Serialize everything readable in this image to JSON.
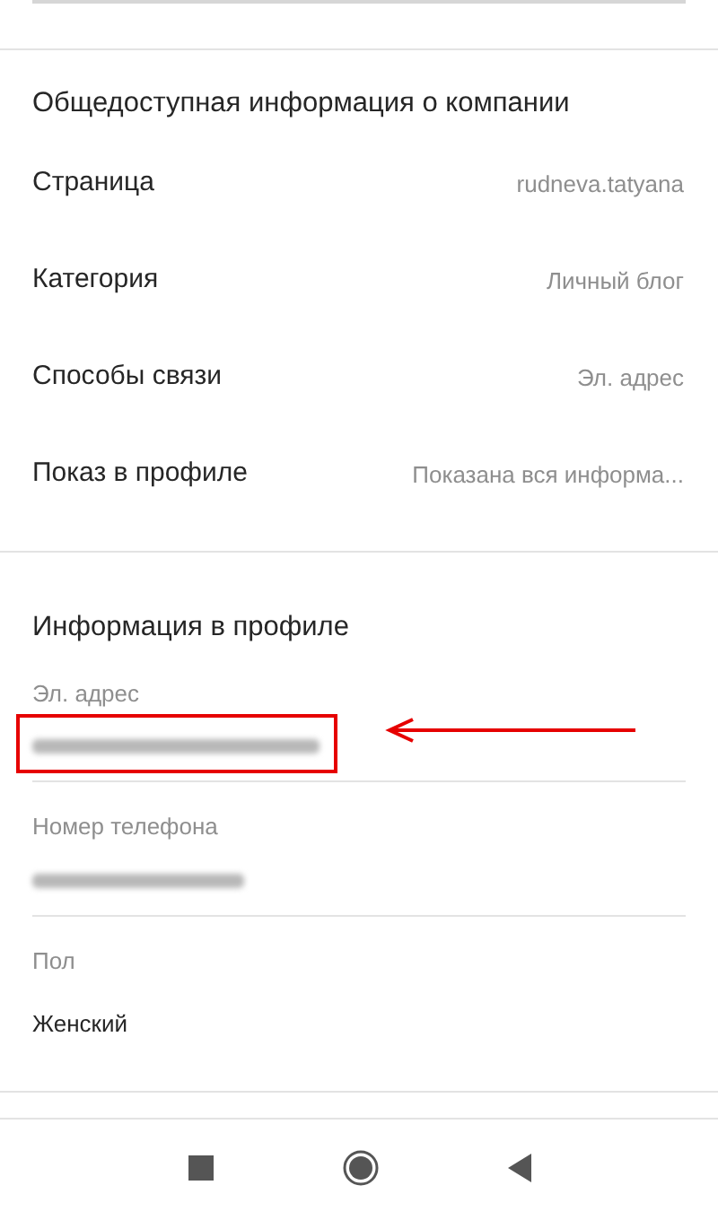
{
  "business_section": {
    "title": "Общедоступная информация о компании",
    "rows": [
      {
        "label": "Страница",
        "value": "rudneva.tatyana"
      },
      {
        "label": "Категория",
        "value": "Личный блог"
      },
      {
        "label": "Способы связи",
        "value": "Эл. адрес"
      },
      {
        "label": "Показ в профиле",
        "value": "Показана вся информа..."
      }
    ]
  },
  "profile_section": {
    "title": "Информация в профиле",
    "fields": [
      {
        "label": "Эл. адрес",
        "redacted": true,
        "highlighted": true
      },
      {
        "label": "Номер телефона",
        "redacted": true,
        "highlighted": false
      },
      {
        "label": "Пол",
        "value": "Женский",
        "redacted": false,
        "highlighted": false
      }
    ]
  }
}
